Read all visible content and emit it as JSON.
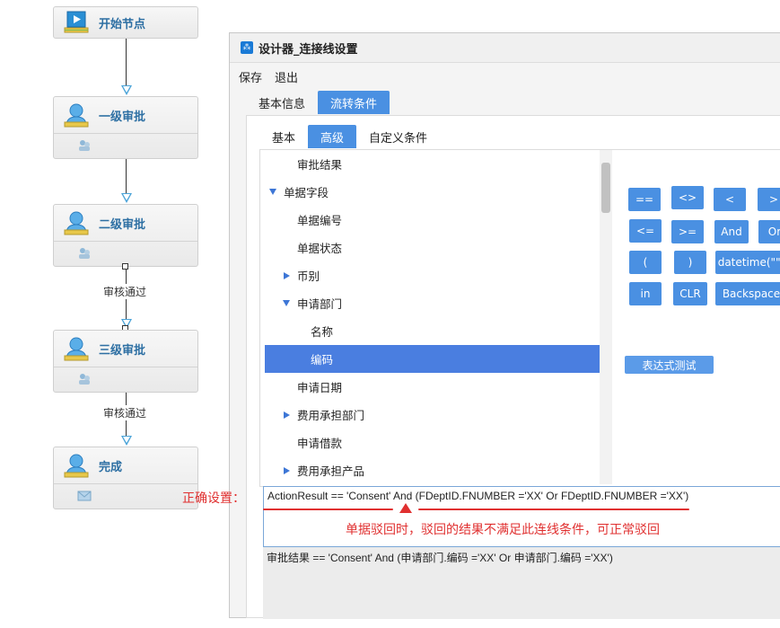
{
  "flow": {
    "nodes": [
      {
        "title": "开始节点"
      },
      {
        "title": "一级审批"
      },
      {
        "title": "二级审批"
      },
      {
        "title": "三级审批"
      },
      {
        "title": "完成"
      }
    ],
    "edge_labels": [
      "审核通过",
      "审核通过"
    ]
  },
  "dialog": {
    "title": "设计器_连接线设置",
    "menu": [
      "保存",
      "退出"
    ],
    "tabs": [
      "基本信息",
      "流转条件"
    ],
    "subtabs": [
      "基本",
      "高级",
      "自定义条件"
    ],
    "tree": [
      {
        "label": "审批结果"
      },
      {
        "label": "单据字段"
      },
      {
        "label": "单据编号"
      },
      {
        "label": "单据状态"
      },
      {
        "label": "币别"
      },
      {
        "label": "申请部门"
      },
      {
        "label": "名称"
      },
      {
        "label": "编码"
      },
      {
        "label": "申请日期"
      },
      {
        "label": "费用承担部门"
      },
      {
        "label": "申请借款"
      },
      {
        "label": "费用承担产品"
      }
    ],
    "operators": [
      "==",
      "<>",
      "<",
      ">",
      "<=",
      ">=",
      "And",
      "Or",
      "(",
      ")",
      "datetime(\"\")",
      "in",
      "CLR",
      "Backspace"
    ],
    "test_button": "表达式测试",
    "expression": "ActionResult == 'Consent'  And (FDeptID.FNUMBER ='XX' Or  FDeptID.FNUMBER ='XX')",
    "preview": "审批结果 == 'Consent'  And (申请部门.编码 ='XX' Or  申请部门.编码 ='XX')"
  },
  "annotation": {
    "label": "正确设置：",
    "note": "单据驳回时，驳回的结果不满足此连线条件，可正常驳回"
  },
  "colors": {
    "accent": "#4a90e2",
    "annotation": "#e03030",
    "node_title": "#2d6fa3"
  }
}
